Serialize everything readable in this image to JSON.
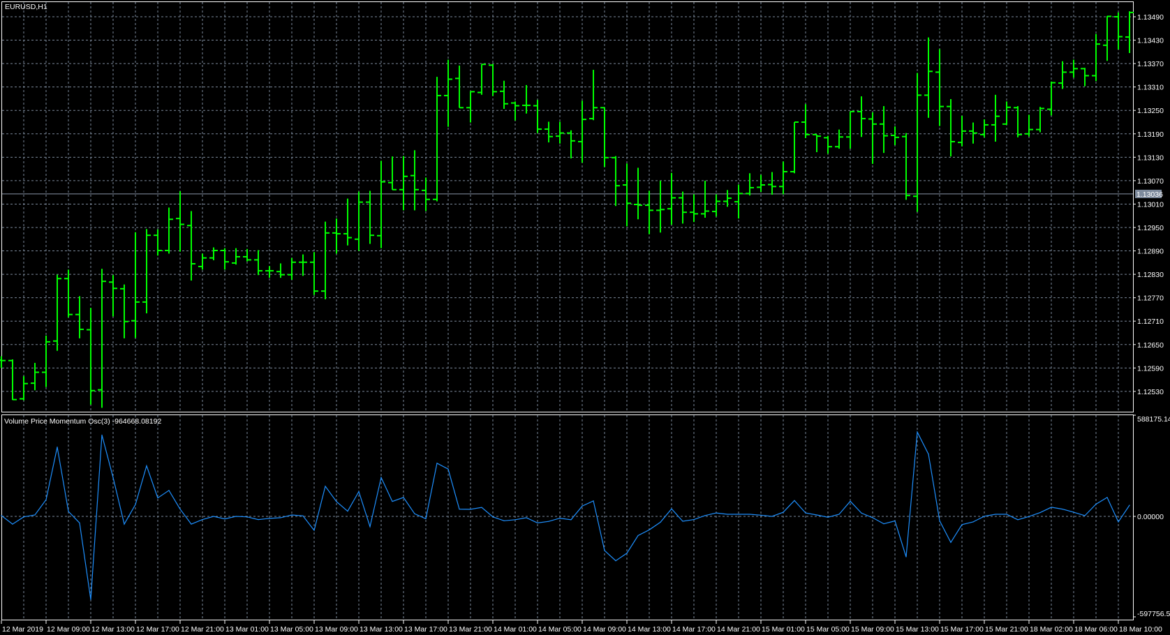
{
  "window": {
    "symbol_title": "EURUSD,H1"
  },
  "colors": {
    "background": "#000000",
    "bars": "#00ff00",
    "grid": "#7d8a9c",
    "axis": "#ffffff",
    "oscillator": "#1e90ff",
    "price_line": "#8a97a8",
    "price_tag_bg": "#7d8a9c"
  },
  "chart_data": [
    {
      "type": "ohlc",
      "title": "EURUSD,H1",
      "current_price_label": "1.13036",
      "current_price": 1.13036,
      "ylim": [
        1.1249,
        1.1352
      ],
      "y_tick_labels": [
        "1.13490",
        "1.13430",
        "1.13370",
        "1.13310",
        "1.13250",
        "1.13190",
        "1.13130",
        "1.13070",
        "1.13010",
        "1.12950",
        "1.12890",
        "1.12830",
        "1.12770",
        "1.12710",
        "1.12650",
        "1.12590",
        "1.12530"
      ],
      "x_tick_labels": [
        "12 Mar 2019",
        "12 Mar 09:00",
        "12 Mar 13:00",
        "12 Mar 17:00",
        "12 Mar 21:00",
        "13 Mar 01:00",
        "13 Mar 05:00",
        "13 Mar 09:00",
        "13 Mar 13:00",
        "13 Mar 17:00",
        "13 Mar 21:00",
        "14 Mar 01:00",
        "14 Mar 05:00",
        "14 Mar 09:00",
        "14 Mar 13:00",
        "14 Mar 17:00",
        "14 Mar 21:00",
        "15 Mar 01:00",
        "15 Mar 05:00",
        "15 Mar 09:00",
        "15 Mar 13:00",
        "15 Mar 17:00",
        "15 Mar 21:00",
        "18 Mar 02:00",
        "18 Mar 06:00",
        "18 Mar 10:00"
      ],
      "grid": true,
      "ohlc_columns": [
        "open",
        "high",
        "low",
        "close"
      ],
      "ohlc": [
        [
          1.1261,
          1.1262,
          1.1259,
          1.12609
        ],
        [
          1.12609,
          1.12612,
          1.12508,
          1.12509
        ],
        [
          1.12511,
          1.12569,
          1.12507,
          1.1255
        ],
        [
          1.12551,
          1.12603,
          1.12533,
          1.12579
        ],
        [
          1.12579,
          1.12673,
          1.12541,
          1.12657
        ],
        [
          1.12659,
          1.12829,
          1.12634,
          1.12819
        ],
        [
          1.12819,
          1.12842,
          1.1272,
          1.12727
        ],
        [
          1.12727,
          1.12774,
          1.12666,
          1.12689
        ],
        [
          1.12688,
          1.12744,
          1.12496,
          1.12532
        ],
        [
          1.12534,
          1.12844,
          1.12488,
          1.12812
        ],
        [
          1.1281,
          1.12828,
          1.12722,
          1.12794
        ],
        [
          1.12793,
          1.12804,
          1.12666,
          1.12709
        ],
        [
          1.12711,
          1.12938,
          1.12667,
          1.12759
        ],
        [
          1.12759,
          1.12946,
          1.1273,
          1.1293
        ],
        [
          1.1293,
          1.12945,
          1.12878,
          1.12891
        ],
        [
          1.12891,
          1.13001,
          1.12883,
          1.12971
        ],
        [
          1.12973,
          1.13043,
          1.12888,
          1.12958
        ],
        [
          1.12955,
          1.12992,
          1.12814,
          1.12857
        ],
        [
          1.1285,
          1.12883,
          1.12842,
          1.12872
        ],
        [
          1.12872,
          1.12899,
          1.12866,
          1.12891
        ],
        [
          1.12891,
          1.12897,
          1.12842,
          1.12862
        ],
        [
          1.12859,
          1.12897,
          1.12855,
          1.12875
        ],
        [
          1.12875,
          1.12895,
          1.12863,
          1.12867
        ],
        [
          1.12867,
          1.12892,
          1.12828,
          1.12839
        ],
        [
          1.12839,
          1.12851,
          1.12821,
          1.12839
        ],
        [
          1.12837,
          1.12858,
          1.12821,
          1.12829
        ],
        [
          1.12829,
          1.12872,
          1.12816,
          1.12861
        ],
        [
          1.12861,
          1.12881,
          1.12826,
          1.12861
        ],
        [
          1.12861,
          1.12887,
          1.12777,
          1.12787
        ],
        [
          1.12787,
          1.12965,
          1.12766,
          1.12936
        ],
        [
          1.12936,
          1.12973,
          1.12883,
          1.12934
        ],
        [
          1.12934,
          1.13024,
          1.12904,
          1.12924
        ],
        [
          1.1292,
          1.13042,
          1.1289,
          1.13015
        ],
        [
          1.13015,
          1.13044,
          1.12908,
          1.1293
        ],
        [
          1.12929,
          1.13121,
          1.12897,
          1.13067
        ],
        [
          1.13065,
          1.13132,
          1.13047,
          1.13047
        ],
        [
          1.13047,
          1.13133,
          1.12994,
          1.13081
        ],
        [
          1.13083,
          1.13148,
          1.12994,
          1.13047
        ],
        [
          1.13045,
          1.13078,
          1.12992,
          1.13022
        ],
        [
          1.13022,
          1.13336,
          1.13017,
          1.13288
        ],
        [
          1.13288,
          1.1338,
          1.13208,
          1.1333
        ],
        [
          1.13332,
          1.13365,
          1.13257,
          1.13257
        ],
        [
          1.13257,
          1.13299,
          1.13219,
          1.13298
        ],
        [
          1.13296,
          1.13368,
          1.1329,
          1.13368
        ],
        [
          1.13366,
          1.13369,
          1.13287,
          1.13298
        ],
        [
          1.13299,
          1.13326,
          1.13254,
          1.13267
        ],
        [
          1.13269,
          1.13273,
          1.13224,
          1.13262
        ],
        [
          1.13263,
          1.13315,
          1.13242,
          1.13263
        ],
        [
          1.13262,
          1.13277,
          1.13192,
          1.13202
        ],
        [
          1.13202,
          1.13221,
          1.13168,
          1.13183
        ],
        [
          1.13184,
          1.13221,
          1.13165,
          1.13192
        ],
        [
          1.13192,
          1.13199,
          1.13127,
          1.13172
        ],
        [
          1.1317,
          1.13275,
          1.13116,
          1.13227
        ],
        [
          1.13229,
          1.13354,
          1.13225,
          1.13257
        ],
        [
          1.13257,
          1.13257,
          1.13105,
          1.13129
        ],
        [
          1.13129,
          1.13133,
          1.13005,
          1.13057
        ],
        [
          1.13059,
          1.13114,
          1.12953,
          1.13012
        ],
        [
          1.13009,
          1.13103,
          1.12971,
          1.13007
        ],
        [
          1.13007,
          1.13044,
          1.12933,
          1.12994
        ],
        [
          1.12994,
          1.1307,
          1.12937,
          1.12996
        ],
        [
          1.12998,
          1.1309,
          1.12957,
          1.13026
        ],
        [
          1.13026,
          1.13042,
          1.1296,
          1.12989
        ],
        [
          1.12989,
          1.13035,
          1.12964,
          1.12985
        ],
        [
          1.12985,
          1.1307,
          1.12975,
          1.12992
        ],
        [
          1.12991,
          1.13035,
          1.12978,
          1.13017
        ],
        [
          1.13017,
          1.13046,
          1.13003,
          1.13025
        ],
        [
          1.13016,
          1.1306,
          1.12973,
          1.13037
        ],
        [
          1.13037,
          1.13089,
          1.13032,
          1.13052
        ],
        [
          1.13053,
          1.13085,
          1.13041,
          1.13059
        ],
        [
          1.1306,
          1.13092,
          1.13034,
          1.13055
        ],
        [
          1.13055,
          1.13119,
          1.13035,
          1.13093
        ],
        [
          1.13093,
          1.1322,
          1.13089,
          1.1322
        ],
        [
          1.1322,
          1.13266,
          1.13179,
          1.13188
        ],
        [
          1.13188,
          1.13188,
          1.13143,
          1.13184
        ],
        [
          1.1318,
          1.13185,
          1.13139,
          1.13157
        ],
        [
          1.13157,
          1.13201,
          1.13152,
          1.13182
        ],
        [
          1.13182,
          1.13247,
          1.13152,
          1.13247
        ],
        [
          1.13247,
          1.13286,
          1.13182,
          1.13229
        ],
        [
          1.13228,
          1.13245,
          1.13113,
          1.13215
        ],
        [
          1.13215,
          1.13261,
          1.13141,
          1.13185
        ],
        [
          1.13186,
          1.13209,
          1.13161,
          1.13181
        ],
        [
          1.13183,
          1.13192,
          1.13021,
          1.13032
        ],
        [
          1.1303,
          1.13346,
          1.1299,
          1.13289
        ],
        [
          1.13289,
          1.13437,
          1.13231,
          1.1335
        ],
        [
          1.13348,
          1.13407,
          1.1321,
          1.1326
        ],
        [
          1.1326,
          1.13279,
          1.13132,
          1.1317
        ],
        [
          1.13168,
          1.13236,
          1.13158,
          1.13197
        ],
        [
          1.13197,
          1.13219,
          1.13165,
          1.13192
        ],
        [
          1.13188,
          1.13227,
          1.13181,
          1.13213
        ],
        [
          1.13213,
          1.1329,
          1.1317,
          1.13235
        ],
        [
          1.13215,
          1.13273,
          1.13213,
          1.13258
        ],
        [
          1.13257,
          1.13261,
          1.13181,
          1.13188
        ],
        [
          1.1319,
          1.13239,
          1.13183,
          1.13201
        ],
        [
          1.13201,
          1.13259,
          1.13194,
          1.13255
        ],
        [
          1.13253,
          1.13324,
          1.13237,
          1.13321
        ],
        [
          1.1332,
          1.13376,
          1.13305,
          1.13348
        ],
        [
          1.13348,
          1.1338,
          1.13334,
          1.13357
        ],
        [
          1.13357,
          1.13359,
          1.13312,
          1.13339
        ],
        [
          1.13339,
          1.13446,
          1.13325,
          1.1342
        ],
        [
          1.13417,
          1.13492,
          1.13377,
          1.13491
        ],
        [
          1.1349,
          1.13501,
          1.13406,
          1.13439
        ],
        [
          1.13438,
          1.13504,
          1.13397,
          1.13501
        ]
      ]
    },
    {
      "type": "line",
      "title": "Volume Price Momentum Osc(3) -964668.08192",
      "ylim": [
        -597756.51,
        588175.149
      ],
      "y_tick_labels": [
        "588175.149",
        "0.00000",
        "-597756.51"
      ],
      "series": [
        {
          "name": "Volume Price Momentum Osc(3)",
          "values": [
            5000,
            -46000,
            -3000,
            8000,
            97000,
            403000,
            29000,
            -39000,
            -495000,
            473000,
            226000,
            -46000,
            69000,
            294000,
            107000,
            151000,
            42000,
            -46000,
            -19000,
            0,
            -15000,
            0,
            -3000,
            -19000,
            -12000,
            -8000,
            8000,
            3000,
            -83000,
            175000,
            86000,
            30000,
            144000,
            -61000,
            226000,
            87000,
            110000,
            15000,
            -14000,
            309000,
            275000,
            42000,
            41000,
            52000,
            -3000,
            -26000,
            -20000,
            -8000,
            -39000,
            -30000,
            -11000,
            -20000,
            60000,
            90000,
            -203000,
            -264000,
            -219000,
            -114000,
            -80000,
            -35000,
            44000,
            -29000,
            -19000,
            5000,
            20000,
            12000,
            12000,
            12000,
            7000,
            0,
            24000,
            92000,
            20000,
            8000,
            -5000,
            12000,
            88000,
            19000,
            -8000,
            -44000,
            -27000,
            -241000,
            490000,
            362000,
            -26000,
            -155000,
            -49000,
            -33000,
            1000,
            12000,
            12000,
            -20000,
            -1000,
            22000,
            53000,
            42000,
            24000,
            4000,
            71000,
            110000,
            -33000,
            65000
          ]
        }
      ]
    }
  ]
}
